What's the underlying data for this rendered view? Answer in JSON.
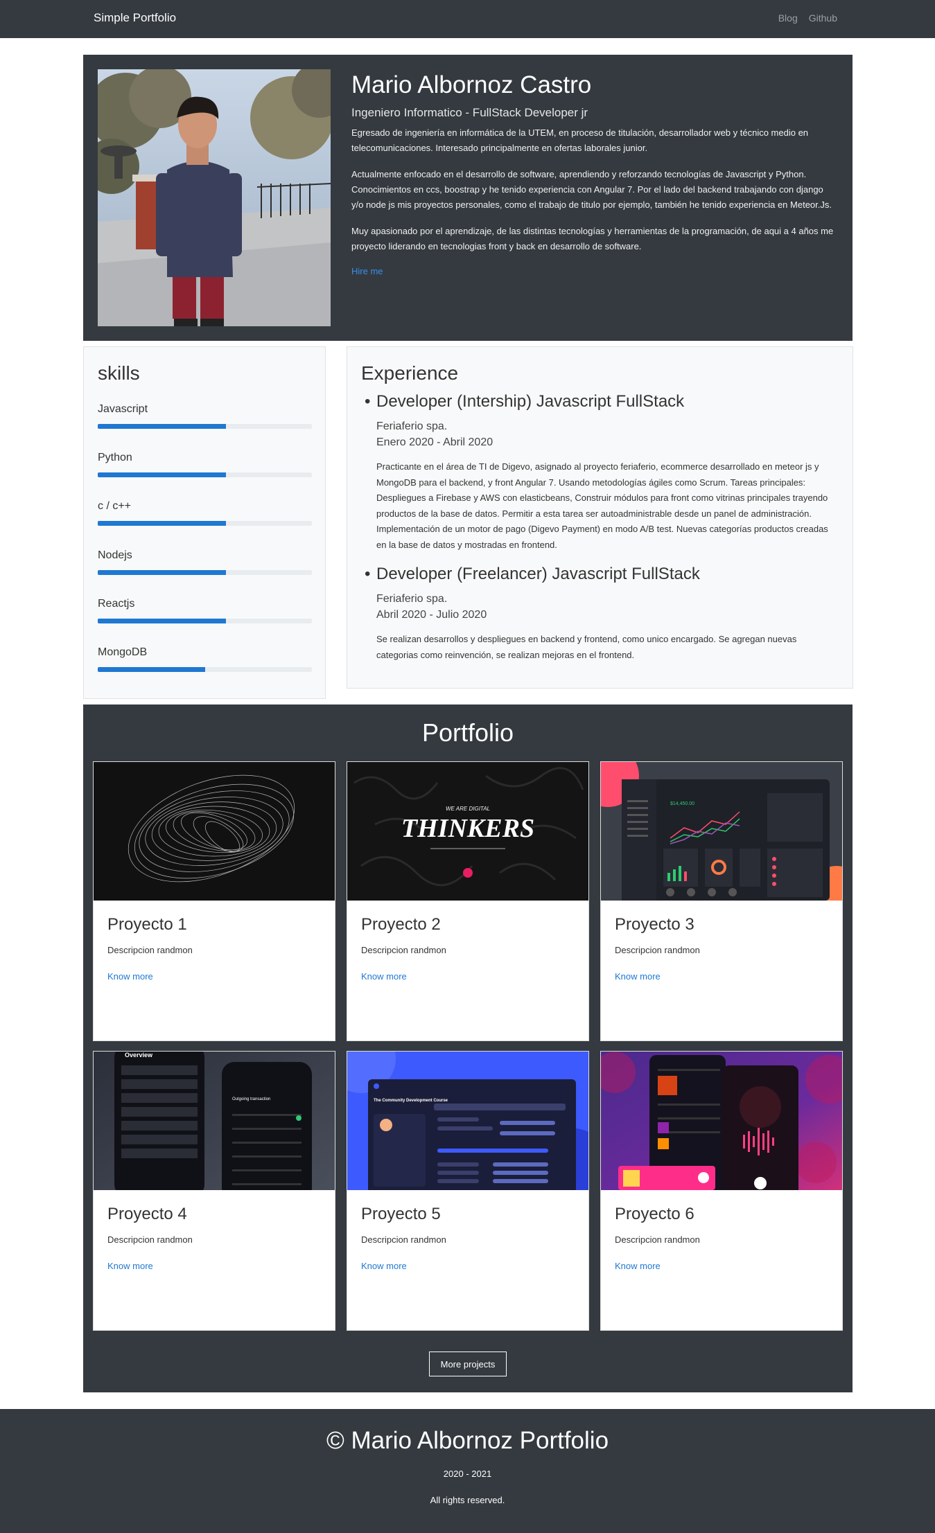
{
  "navbar": {
    "brand": "Simple Portfolio",
    "links": [
      "Blog",
      "Github"
    ]
  },
  "profile": {
    "name": "Mario Albornoz Castro",
    "subtitle": "Ingeniero Informatico - FullStack Developer jr",
    "paragraphs": [
      "Egresado de ingeniería en informática de la UTEM, en proceso de titulación, desarrollador web y técnico medio en telecomunicaciones. Interesado principalmente en ofertas laborales junior.",
      "Actualmente enfocado en el desarrollo de software, aprendiendo y reforzando tecnologías de Javascript y Python. Conocimientos en ccs, boostrap y he tenido experiencia con Angular 7. Por el lado del backend trabajando con django y/o node js mis proyectos personales, como el trabajo de titulo por ejemplo, también he tenido experiencia en Meteor.Js.",
      "Muy apasionado por el aprendizaje, de las distintas tecnologías y herramientas de la programación, de aqui a 4 años me proyecto liderando en tecnologias front y back en desarrollo de software."
    ],
    "hire_label": "Hire me"
  },
  "skills": {
    "title": "skills",
    "items": [
      {
        "name": "Javascript",
        "level": 0.6
      },
      {
        "name": "Python",
        "level": 0.6
      },
      {
        "name": "c / c++",
        "level": 0.6
      },
      {
        "name": "Nodejs",
        "level": 0.6
      },
      {
        "name": "Reactjs",
        "level": 0.6
      },
      {
        "name": "MongoDB",
        "level": 0.5
      }
    ]
  },
  "experience": {
    "title": "Experience",
    "jobs": [
      {
        "role": "Developer (Intership) Javascript FullStack",
        "company": "Feriaferio spa.",
        "dates": "Enero 2020 - Abril 2020",
        "description": "Practicante en el área de TI de Digevo, asignado al proyecto feriaferio, ecommerce desarrollado en meteor js y MongoDB para el backend, y front Angular 7. Usando metodologías ágiles como Scrum. Tareas principales: Despliegues a Firebase y AWS con elasticbeans, Construir módulos para front como vitrinas principales trayendo productos de la base de datos. Permitir a esta tarea ser autoadministrable desde un panel de administración. Implementación de un motor de pago (Digevo Payment) en modo A/B test. Nuevas categorías productos creadas en la base de datos y mostradas en frontend."
      },
      {
        "role": "Developer (Freelancer) Javascript FullStack",
        "company": "Feriaferio spa.",
        "dates": "Abril 2020 - Julio 2020",
        "description": "Se realizan desarrollos y despliegues en backend y frontend, como unico encargado. Se agregan nuevas categorias como reinvención, se realizan mejoras en el frontend."
      }
    ]
  },
  "portfolio": {
    "title": "Portfolio",
    "projects": [
      {
        "title": "Proyecto 1",
        "description": "Descripcion randmon",
        "link": "Know more"
      },
      {
        "title": "Proyecto 2",
        "description": "Descripcion randmon",
        "link": "Know more"
      },
      {
        "title": "Proyecto 3",
        "description": "Descripcion randmon",
        "link": "Know more"
      },
      {
        "title": "Proyecto 4",
        "description": "Descripcion randmon",
        "link": "Know more"
      },
      {
        "title": "Proyecto 5",
        "description": "Descripcion randmon",
        "link": "Know more"
      },
      {
        "title": "Proyecto 6",
        "description": "Descripcion randmon",
        "link": "Know more"
      }
    ],
    "thumb_texts": {
      "thinkers_small": "WE ARE DIGITAL",
      "thinkers_big": "THINKERS",
      "overview": "Overview",
      "outgoing": "Outgoing transaction",
      "course": "The Community Development Course",
      "dashboard_balance": "$14,450.00"
    },
    "more_label": "More projects"
  },
  "footer": {
    "title": "© Mario Albornoz Portfolio",
    "years": "2020 - 2021",
    "rights": "All rights reserved."
  },
  "colors": {
    "dark": "#343a40",
    "accent": "#1f78d1",
    "light": "#f8f9fa"
  }
}
